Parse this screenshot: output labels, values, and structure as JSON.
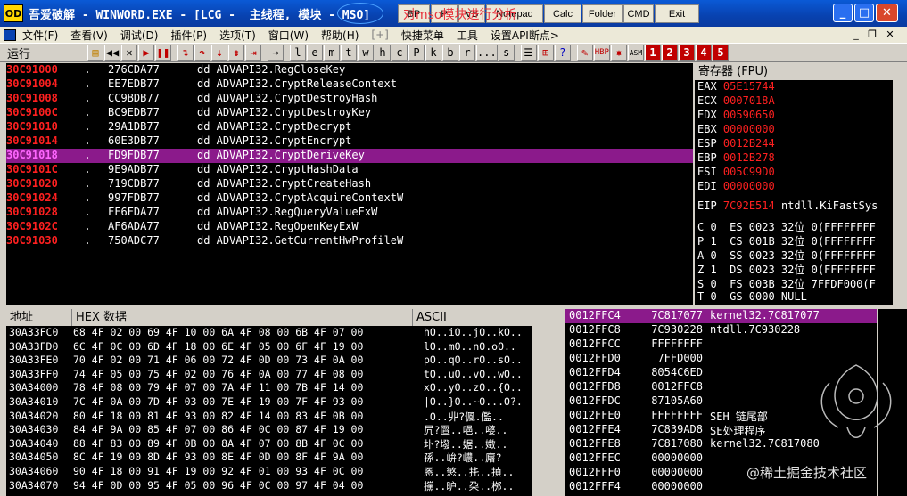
{
  "titlebar": {
    "app_icon_text": "OD",
    "title": "吾爱破解 - WINWORD.EXE - [LCG -  主线程, 模块 - MSO]",
    "annotation": "对mso模块进行分析",
    "buttons": [
      "BP",
      "P",
      "VB",
      "Notepad",
      "Calc",
      "Folder",
      "CMD",
      "Exit"
    ]
  },
  "menubar": {
    "items": [
      "文件(F)",
      "查看(V)",
      "调试(D)",
      "插件(P)",
      "选项(T)",
      "窗口(W)",
      "帮助(H)",
      "[+]",
      "快捷菜单",
      "工具",
      "设置API断点>"
    ]
  },
  "toolbar": {
    "status": "运行",
    "letters": [
      "l",
      "e",
      "m",
      "t",
      "w",
      "h",
      "c",
      "P",
      "k",
      "b",
      "r",
      "...",
      "s"
    ],
    "numbers": [
      "1",
      "2",
      "3",
      "4",
      "5"
    ]
  },
  "disasm": {
    "rows": [
      {
        "addr": "30C91000",
        "dot": ".",
        "hex": "276CDA77",
        "ins": "dd ADVAPI32.RegCloseKey"
      },
      {
        "addr": "30C91004",
        "dot": ".",
        "hex": "EE7EDB77",
        "ins": "dd ADVAPI32.CryptReleaseContext"
      },
      {
        "addr": "30C91008",
        "dot": ".",
        "hex": "CC9BDB77",
        "ins": "dd ADVAPI32.CryptDestroyHash"
      },
      {
        "addr": "30C9100C",
        "dot": ".",
        "hex": "BC9EDB77",
        "ins": "dd ADVAPI32.CryptDestroyKey"
      },
      {
        "addr": "30C91010",
        "dot": ".",
        "hex": "29A1DB77",
        "ins": "dd ADVAPI32.CryptDecrypt"
      },
      {
        "addr": "30C91014",
        "dot": ".",
        "hex": "60E3DB77",
        "ins": "dd ADVAPI32.CryptEncrypt"
      },
      {
        "addr": "30C91018",
        "dot": ".",
        "hex": "FD9FDB77",
        "ins": "dd ADVAPI32.CryptDeriveKey"
      },
      {
        "addr": "30C9101C",
        "dot": ".",
        "hex": "9E9ADB77",
        "ins": "dd ADVAPI32.CryptHashData"
      },
      {
        "addr": "30C91020",
        "dot": ".",
        "hex": "719CDB77",
        "ins": "dd ADVAPI32.CryptCreateHash"
      },
      {
        "addr": "30C91024",
        "dot": ".",
        "hex": "997FDB77",
        "ins": "dd ADVAPI32.CryptAcquireContextW"
      },
      {
        "addr": "30C91028",
        "dot": ".",
        "hex": "FF6FDA77",
        "ins": "dd ADVAPI32.RegQueryValueExW"
      },
      {
        "addr": "30C9102C",
        "dot": ".",
        "hex": "AF6ADA77",
        "ins": "dd ADVAPI32.RegOpenKeyExW"
      },
      {
        "addr": "30C91030",
        "dot": ".",
        "hex": "750ADC77",
        "ins": "dd ADVAPI32.GetCurrentHwProfileW"
      }
    ]
  },
  "registers": {
    "header": "寄存器 (FPU)",
    "regs": [
      {
        "name": "EAX",
        "value": "05E15744"
      },
      {
        "name": "ECX",
        "value": "0007018A"
      },
      {
        "name": "EDX",
        "value": "00590650"
      },
      {
        "name": "EBX",
        "value": "00000000"
      },
      {
        "name": "ESP",
        "value": "0012B244"
      },
      {
        "name": "EBP",
        "value": "0012B278"
      },
      {
        "name": "ESI",
        "value": "005C99D0"
      },
      {
        "name": "EDI",
        "value": "00000000"
      }
    ],
    "eip": {
      "name": "EIP",
      "value": "7C92E514",
      "comment": "ntdll.KiFastSys"
    },
    "flags": [
      "C 0  ES 0023 32位 0(FFFFFFFF",
      "P 1  CS 001B 32位 0(FFFFFFFF",
      "A 0  SS 0023 32位 0(FFFFFFFF",
      "Z 1  DS 0023 32位 0(FFFFFFFF",
      "S 0  FS 003B 32位 7FFDF000(F",
      "T 0  GS 0000 NULL"
    ]
  },
  "dump": {
    "col_addr": "地址",
    "col_hex": "HEX 数据",
    "col_ascii": "ASCII",
    "rows": [
      {
        "a": "30A33FC0",
        "h": "68 4F 02 00 69 4F 10 00 6A 4F 08 00 6B 4F 07 00",
        "s": "hO..iO..jO..kO.."
      },
      {
        "a": "30A33FD0",
        "h": "6C 4F 0C 00 6D 4F 18 00 6E 4F 05 00 6F 4F 19 00",
        "s": "lO..mO..nO.oO.."
      },
      {
        "a": "30A33FE0",
        "h": "70 4F 02 00 71 4F 06 00 72 4F 0D 00 73 4F 0A 00",
        "s": "pO..qO..rO..sO.."
      },
      {
        "a": "30A33FF0",
        "h": "74 4F 05 00 75 4F 02 00 76 4F 0A 00 77 4F 08 00",
        "s": "tO..uO..vO..wO.."
      },
      {
        "a": "30A34000",
        "h": "78 4F 08 00 79 4F 07 00 7A 4F 11 00 7B 4F 14 00",
        "s": "xO..yO..zO..{O.."
      },
      {
        "a": "30A34010",
        "h": "7C 4F 0A 00 7D 4F 03 00 7E 4F 19 00 7F 4F 93 00",
        "s": "|O..}O..~O...O?."
      },
      {
        "a": "30A34020",
        "h": "80 4F 18 00 81 4F 93 00 82 4F 14 00 83 4F 0B 00",
        "s": ".O..丱?偑.儖.."
      },
      {
        "a": "30A34030",
        "h": "84 4F 9A 00 85 4F 07 00 86 4F 0C 00 87 4F 19 00",
        "s": "凥?匫..唈..嘙.."
      },
      {
        "a": "30A34040",
        "h": "88 4F 83 00 89 4F 0B 00 8A 4F 07 00 8B 4F 0C 00",
        "s": "圤?墢..婮..嬍.."
      },
      {
        "a": "30A34050",
        "h": "8C 4F 19 00 8D 4F 93 00 8E 4F 0D 00 8F 4F 9A 00",
        "s": "孫..峅?嶩..廜?"
      },
      {
        "a": "30A34060",
        "h": "90 4F 18 00 91 4F 19 00 92 4F 01 00 93 4F 0C 00",
        "s": "悘..慜..扥..揁.."
      },
      {
        "a": "30A34070",
        "h": "94 4F 0D 00 95 4F 05 00 96 4F 0C 00 97 4F 04 00",
        "s": "攩..昈..朶..桞.."
      }
    ]
  },
  "stack": {
    "rows": [
      {
        "a": "0012FFC4",
        "v": "7C817077",
        "c": "kernel32.7C817077"
      },
      {
        "a": "0012FFC8",
        "v": "7C930228",
        "c": "ntdll.7C930228"
      },
      {
        "a": "0012FFCC",
        "v": "FFFFFFFF",
        "c": ""
      },
      {
        "a": "0012FFD0",
        "v": "7FFD000",
        "c": ""
      },
      {
        "a": "0012FFD4",
        "v": "8054C6ED",
        "c": ""
      },
      {
        "a": "0012FFD8",
        "v": "0012FFC8",
        "c": ""
      },
      {
        "a": "0012FFDC",
        "v": "87105A60",
        "c": ""
      },
      {
        "a": "0012FFE0",
        "v": "FFFFFFFF",
        "c": "SEH 链尾部"
      },
      {
        "a": "0012FFE4",
        "v": "7C839AD8",
        "c": "SE处理程序"
      },
      {
        "a": "0012FFE8",
        "v": "7C817080",
        "c": "kernel32.7C817080"
      },
      {
        "a": "0012FFEC",
        "v": "00000000",
        "c": ""
      },
      {
        "a": "0012FFF0",
        "v": "00000000",
        "c": ""
      },
      {
        "a": "0012FFF4",
        "v": "00000000",
        "c": ""
      }
    ]
  },
  "watermark": "@稀土掘金技术社区",
  "colors": {
    "selection": "#8b1a8b",
    "address": "#ff2020",
    "register_value": "#ff2020",
    "title_blue": "#0842b0"
  }
}
